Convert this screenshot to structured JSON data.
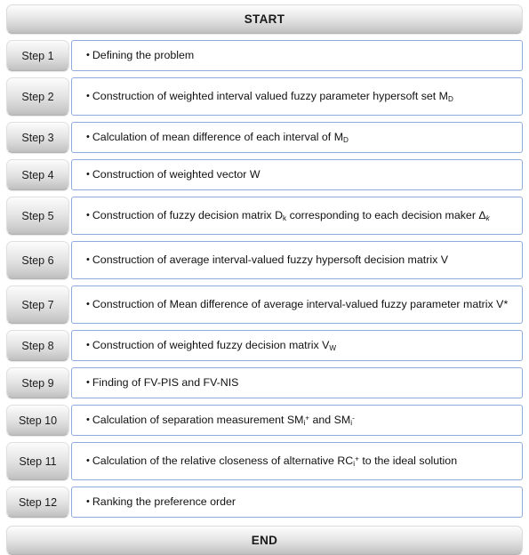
{
  "chart_data": {
    "type": "diagram",
    "title": "TOPSIS-based fuzzy hypersoft decision algorithm flowchart",
    "start_label": "START",
    "end_label": "END",
    "step_count": 12,
    "steps": [
      {
        "label": "Step 1",
        "text": "Defining the problem"
      },
      {
        "label": "Step 2",
        "text": "Construction of weighted interval valued fuzzy parameter hypersoft set MD"
      },
      {
        "label": "Step 3",
        "text": "Calculation of mean difference of each interval of MD"
      },
      {
        "label": "Step 4",
        "text": "Construction of weighted vector W"
      },
      {
        "label": "Step 5",
        "text": "Construction of fuzzy decision matrix Dk corresponding to each decision maker Δk"
      },
      {
        "label": "Step 6",
        "text": "Construction of average interval-valued fuzzy hypersoft decision matrix V"
      },
      {
        "label": "Step 7",
        "text": "Construction of Mean difference of average interval-valued fuzzy parameter matrix V*"
      },
      {
        "label": "Step 8",
        "text": "Construction of weighted fuzzy decision matrix VW"
      },
      {
        "label": "Step 9",
        "text": "Finding of FV-PIS and FV-NIS"
      },
      {
        "label": "Step 10",
        "text": "Calculation of separation measurement SMi+ and SMi-"
      },
      {
        "label": "Step 11",
        "text": "Calculation of the relative closeness of alternative RCi+ to the ideal solution"
      },
      {
        "label": "Step 12",
        "text": "Ranking the preference order"
      }
    ]
  },
  "terminators": {
    "start_label": "START",
    "end_label": "END"
  },
  "steps": [
    {
      "label": "Step 1",
      "lines": 1,
      "segments": [
        {
          "t": "Defining the problem"
        }
      ]
    },
    {
      "label": "Step 2",
      "lines": 2,
      "segments": [
        {
          "t": "Construction of weighted interval valued fuzzy parameter hypersoft set M"
        },
        {
          "t": "D",
          "k": "sub"
        }
      ]
    },
    {
      "label": "Step 3",
      "lines": 1,
      "segments": [
        {
          "t": "Calculation of mean difference of each interval of M"
        },
        {
          "t": "D",
          "k": "sub"
        }
      ]
    },
    {
      "label": "Step 4",
      "lines": 1,
      "segments": [
        {
          "t": "Construction of weighted vector W"
        }
      ]
    },
    {
      "label": "Step 5",
      "lines": 2,
      "segments": [
        {
          "t": "Construction of fuzzy decision matrix D"
        },
        {
          "t": "k",
          "k": "sub"
        },
        {
          "t": " corresponding to each decision maker Δ"
        },
        {
          "t": "k",
          "k": "subi"
        }
      ]
    },
    {
      "label": "Step 6",
      "lines": 2,
      "segments": [
        {
          "t": "Construction of average interval-valued fuzzy hypersoft decision matrix V"
        }
      ]
    },
    {
      "label": "Step 7",
      "lines": 2,
      "segments": [
        {
          "t": "Construction of Mean difference of average interval-valued fuzzy parameter matrix V*"
        }
      ]
    },
    {
      "label": "Step 8",
      "lines": 1,
      "segments": [
        {
          "t": "Construction of weighted fuzzy decision matrix V"
        },
        {
          "t": "W",
          "k": "sub"
        }
      ]
    },
    {
      "label": "Step 9",
      "lines": 1,
      "segments": [
        {
          "t": "Finding of FV-PIS and FV-NIS"
        }
      ]
    },
    {
      "label": "Step 10",
      "lines": 1,
      "segments": [
        {
          "t": "Calculation of separation measurement SM"
        },
        {
          "t": "i",
          "k": "sub"
        },
        {
          "t": "+",
          "k": "sup"
        },
        {
          "t": " and SM"
        },
        {
          "t": "i",
          "k": "sub"
        },
        {
          "t": "-",
          "k": "sup"
        }
      ]
    },
    {
      "label": "Step 11",
      "lines": 2,
      "segments": [
        {
          "t": "Calculation of the relative closeness of alternative RC"
        },
        {
          "t": "i",
          "k": "sub"
        },
        {
          "t": "+",
          "k": "sup"
        },
        {
          "t": " to the ideal solution"
        }
      ]
    },
    {
      "label": "Step 12",
      "lines": 1,
      "segments": [
        {
          "t": "Ranking the preference order"
        }
      ]
    }
  ],
  "colors": {
    "box_border": "#8faadc",
    "box_background": "#ffffff",
    "pill_gradient_top": "#fcfcfc",
    "pill_gradient_bottom": "#bdbdbd",
    "text": "#111111",
    "page_background": "#ffffff"
  },
  "bullet_glyph": "•"
}
